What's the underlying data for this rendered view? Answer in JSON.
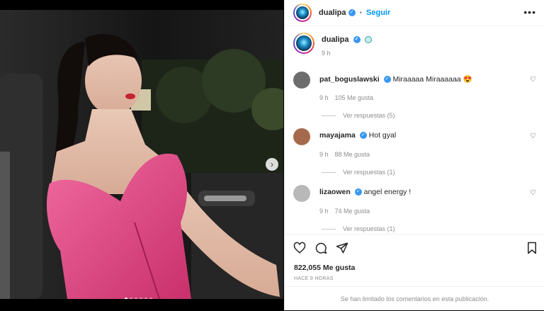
{
  "post": {
    "username": "dualipa",
    "follow_label": "Seguir",
    "separator": "•",
    "more_label": "•••",
    "caption_time": "9 h",
    "carousel_count": 6,
    "carousel_active": 0,
    "next_glyph": "›"
  },
  "comments": [
    {
      "user": "pat_boguslawski",
      "text": "Miraaaaa Miraaaaaa 😍",
      "time": "9 h",
      "likes": "105 Me gusta",
      "replies": "Ver respuestas (5)",
      "avatar_color": "#6d6d6d"
    },
    {
      "user": "mayajama",
      "text": "Hot gyal",
      "time": "9 h",
      "likes": "88 Me gusta",
      "replies": "Ver respuestas (1)",
      "avatar_color": "#a56a4d"
    },
    {
      "user": "lizaowen",
      "text": "angel energy !",
      "time": "9 h",
      "likes": "74 Me gusta",
      "replies": "Ver respuestas (1)",
      "avatar_color": "#b8b8b8"
    }
  ],
  "footer": {
    "likes": "822,055 Me gusta",
    "date": "HACE 9 HORAS",
    "limited": "Se han limitado los comentarios en esta publicación."
  },
  "icons": [
    "heart-icon",
    "comment-icon",
    "share-icon",
    "bookmark-icon",
    "verified-icon",
    "globe-icon",
    "chevron-right-icon"
  ],
  "colors": {
    "accent": "#0095f6",
    "verified": "#3897f0",
    "dress": "#e0457f"
  }
}
